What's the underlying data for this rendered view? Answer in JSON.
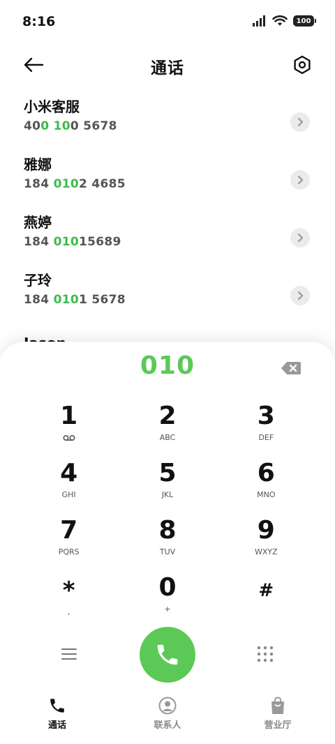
{
  "status": {
    "time": "8:16",
    "battery": "100"
  },
  "header": {
    "title": "通话",
    "back_icon": "arrow-left-icon",
    "settings_icon": "settings-hexagon-icon"
  },
  "contacts": [
    {
      "name": "小米客服",
      "number_parts": [
        {
          "text": "40",
          "hl": false
        },
        {
          "text": "0",
          "hl": true
        },
        {
          "text": " ",
          "hl": false
        },
        {
          "text": "10",
          "hl": true
        },
        {
          "text": "0 5678",
          "hl": false
        }
      ]
    },
    {
      "name": "雅娜",
      "number_parts": [
        {
          "text": "184 ",
          "hl": false
        },
        {
          "text": "010",
          "hl": true
        },
        {
          "text": "2 4685",
          "hl": false
        }
      ]
    },
    {
      "name": "燕婷",
      "number_parts": [
        {
          "text": "184 ",
          "hl": false
        },
        {
          "text": "010",
          "hl": true
        },
        {
          "text": "15689",
          "hl": false
        }
      ]
    },
    {
      "name": "子玲",
      "number_parts": [
        {
          "text": "184 ",
          "hl": false
        },
        {
          "text": "010",
          "hl": true
        },
        {
          "text": "1 5678",
          "hl": false
        }
      ]
    }
  ],
  "partial_contact": "Jason",
  "dialer": {
    "dialed": "010",
    "keys": [
      {
        "digit": "1",
        "letters": "",
        "icon": "voicemail-icon"
      },
      {
        "digit": "2",
        "letters": "ABC"
      },
      {
        "digit": "3",
        "letters": "DEF"
      },
      {
        "digit": "4",
        "letters": "GHI"
      },
      {
        "digit": "5",
        "letters": "JKL"
      },
      {
        "digit": "6",
        "letters": "MNO"
      },
      {
        "digit": "7",
        "letters": "PQRS"
      },
      {
        "digit": "8",
        "letters": "TUV"
      },
      {
        "digit": "9",
        "letters": "WXYZ"
      },
      {
        "digit": "*",
        "letters": ","
      },
      {
        "digit": "0",
        "letters": "+"
      },
      {
        "digit": "#",
        "letters": ""
      }
    ]
  },
  "tabs": [
    {
      "label": "通话",
      "icon": "phone-icon",
      "active": true
    },
    {
      "label": "联系人",
      "icon": "contact-icon",
      "active": false
    },
    {
      "label": "营业厅",
      "icon": "shopping-bag-icon",
      "active": false
    }
  ],
  "colors": {
    "accent": "#5cc957",
    "highlight": "#3dbb4a"
  }
}
